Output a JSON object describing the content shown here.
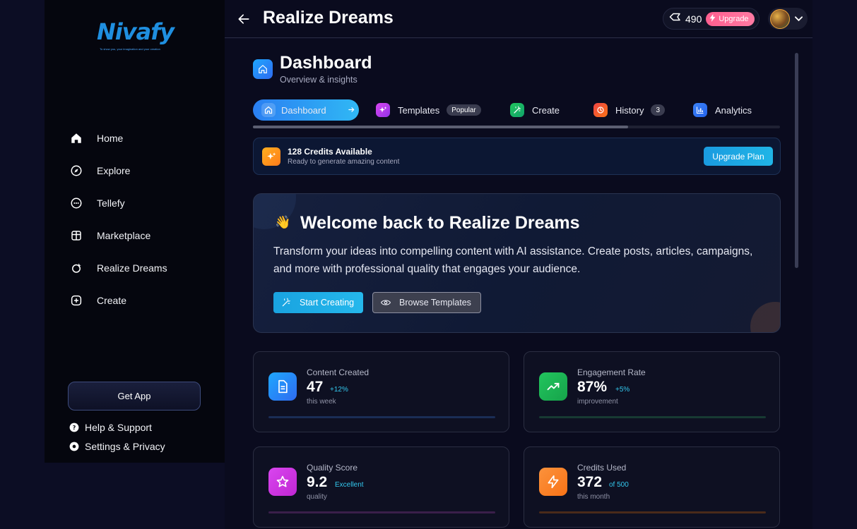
{
  "brand": {
    "name": "Nivafy",
    "tagline": "To show you, your imagination and your creation"
  },
  "sidebar": {
    "items": [
      {
        "label": "Home",
        "icon": "home-icon"
      },
      {
        "label": "Explore",
        "icon": "compass-icon"
      },
      {
        "label": "Tellefy",
        "icon": "chat-icon"
      },
      {
        "label": "Marketplace",
        "icon": "store-icon"
      },
      {
        "label": "Realize Dreams",
        "icon": "sparkle-icon"
      },
      {
        "label": "Create",
        "icon": "plus-square-icon"
      }
    ],
    "get_app": "Get App",
    "help": "Help & Support",
    "settings": "Settings & Privacy"
  },
  "header": {
    "title": "Realize Dreams",
    "credits": "490",
    "upgrade": "Upgrade"
  },
  "dashboard": {
    "title": "Dashboard",
    "subtitle": "Overview & insights"
  },
  "tabs": [
    {
      "label": "Dashboard",
      "active": true
    },
    {
      "label": "Templates",
      "badge": "Popular"
    },
    {
      "label": "Create"
    },
    {
      "label": "History",
      "badge": "3"
    },
    {
      "label": "Analytics"
    }
  ],
  "credits_bar": {
    "title": "128 Credits Available",
    "subtitle": "Ready to generate amazing content",
    "button": "Upgrade Plan"
  },
  "welcome": {
    "emoji": "👋",
    "title": "Welcome back to Realize Dreams",
    "text": "Transform your ideas into compelling content with AI assistance. Create posts, articles, campaigns, and more with professional quality that engages your audience.",
    "start": "Start Creating",
    "browse": "Browse Templates"
  },
  "stats": [
    {
      "label": "Content Created",
      "value": "47",
      "delta": "+12%",
      "sub": "this week",
      "color": "#2196f3"
    },
    {
      "label": "Engagement Rate",
      "value": "87%",
      "delta": "+5%",
      "sub": "improvement",
      "color": "#22c55e"
    },
    {
      "label": "Quality Score",
      "value": "9.2",
      "delta": "Excellent",
      "sub": "quality",
      "color": "#c026d3"
    },
    {
      "label": "Credits Used",
      "value": "372",
      "delta": "of 500",
      "sub": "this month",
      "color": "#f97316"
    }
  ]
}
